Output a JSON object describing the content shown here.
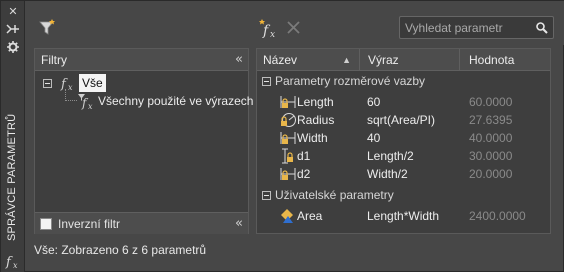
{
  "window": {
    "vertical_title": "SPRÁVCE PARAMETRŮ"
  },
  "toolbar": {
    "search_placeholder": "Vyhledat parametr",
    "icons": [
      "filter-icon",
      "new-parameter-icon",
      "delete-icon",
      "search-icon"
    ]
  },
  "filters": {
    "header": "Filtry",
    "tree": [
      {
        "label": "Vše",
        "selected": true,
        "expanded": true
      },
      {
        "label": "Všechny použité ve výrazech",
        "selected": false
      }
    ],
    "footer": {
      "inverse_label": "Inverzní filtr",
      "checked": false
    }
  },
  "grid": {
    "columns": {
      "name": "Název",
      "expression": "Výraz",
      "value": "Hodnota"
    },
    "groups": [
      {
        "title": "Parametry rozměrové vazby",
        "rows": [
          {
            "icon": "linear-lock-icon",
            "name": "Length",
            "expression": "60",
            "value": "60.0000"
          },
          {
            "icon": "radius-lock-icon",
            "name": "Radius",
            "expression": "sqrt(Area/PI)",
            "value": "27.6395"
          },
          {
            "icon": "linear-lock-icon",
            "name": "Width",
            "expression": "40",
            "value": "40.0000"
          },
          {
            "icon": "vertical-lock-icon",
            "name": "d1",
            "expression": "Length/2",
            "value": "30.0000"
          },
          {
            "icon": "linear-lock-icon",
            "name": "d2",
            "expression": "Width/2",
            "value": "20.0000"
          }
        ]
      },
      {
        "title": "Uživatelské parametry",
        "rows": [
          {
            "icon": "user-parameter-icon",
            "name": "Area",
            "expression": "Length*Width",
            "value": "2400.0000"
          }
        ]
      }
    ]
  },
  "status": "Vše: Zobrazeno 6 z 6 parametrů",
  "colors": {
    "background": "#474747",
    "panel": "#3e3e3e",
    "header": "#4d4d4d",
    "accent_lock": "#e8b64a",
    "accent_user": "#2f6fd0"
  }
}
